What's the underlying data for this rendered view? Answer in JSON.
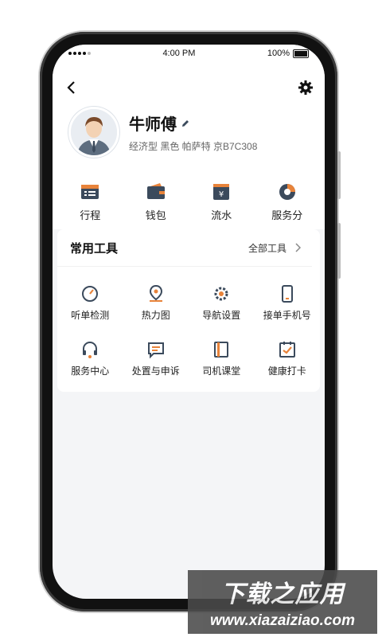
{
  "status": {
    "time": "4:00 PM",
    "battery": "100%"
  },
  "profile": {
    "name": "牛师傅",
    "car": "经济型 黑色 帕萨特 京B7C308"
  },
  "quick": [
    {
      "label": "行程",
      "icon": "itinerary-icon"
    },
    {
      "label": "钱包",
      "icon": "wallet-icon"
    },
    {
      "label": "流水",
      "icon": "earnings-icon"
    },
    {
      "label": "服务分",
      "icon": "service-score-icon"
    }
  ],
  "tools": {
    "title": "常用工具",
    "all_label": "全部工具",
    "items": [
      {
        "label": "听单检测",
        "icon": "order-check-icon"
      },
      {
        "label": "热力图",
        "icon": "heatmap-pin-icon"
      },
      {
        "label": "导航设置",
        "icon": "navigation-settings-icon"
      },
      {
        "label": "接单手机号",
        "icon": "phone-number-icon"
      },
      {
        "label": "服务中心",
        "icon": "headset-icon"
      },
      {
        "label": "处置与申诉",
        "icon": "complaint-icon"
      },
      {
        "label": "司机课堂",
        "icon": "classroom-icon"
      },
      {
        "label": "健康打卡",
        "icon": "health-checkin-icon"
      }
    ]
  },
  "watermark": {
    "line1": "下载之应用",
    "line2": "www.xiazaiziao.com"
  },
  "colors": {
    "accent": "#e8833a",
    "dark": "#3b4a5c"
  }
}
